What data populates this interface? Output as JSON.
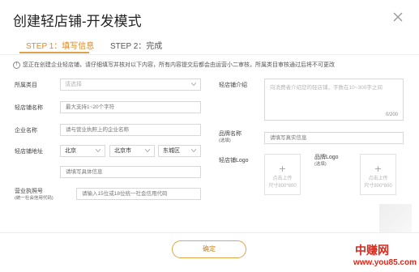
{
  "dialog": {
    "title": "创建轻店铺-开发模式",
    "close_icon": "close-icon"
  },
  "steps": {
    "step1": "STEP 1：填写信息",
    "step2": "STEP 2：完成"
  },
  "notice": "您正在创建企业轻店铺，请仔细填写并核对以下内容，所有内容提交后都会由运营小二审核，所属类目审核通过后将不可更改",
  "form": {
    "category": {
      "label": "所属类目",
      "placeholder": "请选择"
    },
    "shop_name": {
      "label": "轻店铺名称",
      "placeholder": "最大支持1~20个字符"
    },
    "company_name": {
      "label": "企业名称",
      "placeholder": "请与营业执照上的企业名称"
    },
    "address": {
      "label": "轻店铺地址",
      "province": "北京",
      "city": "北京市",
      "district": "东城区",
      "detail_placeholder": "请填写具体信息"
    },
    "license": {
      "label": "营业执照号",
      "sublabel": "(统一社会信用代码)",
      "placeholder": "请输入15位或18位统一社会信用代码"
    },
    "intro": {
      "label": "轻店铺介绍",
      "placeholder": "向消费者介绍您的轻店铺，字数在10~300字之间",
      "counter": "0/200"
    },
    "brand_name": {
      "label": "品牌名称",
      "sublabel": "(选填)",
      "placeholder": "请填写真实信息"
    },
    "shop_logo": {
      "label": "轻店铺Logo",
      "upload_text": "点击上传",
      "size_hint": "尺寸800*800"
    },
    "brand_logo": {
      "label": "品牌Logo",
      "sublabel": "(选填)",
      "upload_text": "点击上传",
      "size_hint": "尺寸800*800"
    }
  },
  "footer": {
    "confirm_label": "确定"
  },
  "watermark": {
    "line1": "中赚网",
    "line2": "www.you85.com"
  },
  "colors": {
    "accent": "#e2a04a",
    "step_active": "#d98a2b",
    "watermark": "#d42a1e"
  }
}
